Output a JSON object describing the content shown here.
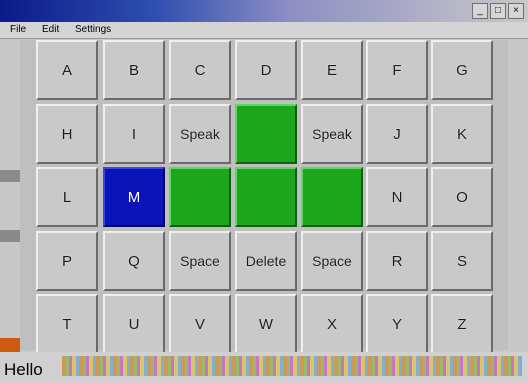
{
  "window": {
    "title": ""
  },
  "menu": [
    "File",
    "Edit",
    "Settings"
  ],
  "window_buttons": [
    "_",
    "□",
    "×"
  ],
  "grid": {
    "rows": [
      [
        {
          "label": "A"
        },
        {
          "label": "B"
        },
        {
          "label": "C"
        },
        {
          "label": "D"
        },
        {
          "label": "E"
        },
        {
          "label": "F"
        },
        {
          "label": "G"
        }
      ],
      [
        {
          "label": "H"
        },
        {
          "label": "I"
        },
        {
          "label": "Speak"
        },
        {
          "label": "",
          "color": "green"
        },
        {
          "label": "Speak"
        },
        {
          "label": "J"
        },
        {
          "label": "K"
        }
      ],
      [
        {
          "label": "L"
        },
        {
          "label": "M",
          "color": "blue"
        },
        {
          "label": "",
          "color": "green"
        },
        {
          "label": "",
          "color": "green"
        },
        {
          "label": "",
          "color": "green"
        },
        {
          "label": "N"
        },
        {
          "label": "O"
        }
      ],
      [
        {
          "label": "P"
        },
        {
          "label": "Q"
        },
        {
          "label": "Space"
        },
        {
          "label": "Delete"
        },
        {
          "label": "Space"
        },
        {
          "label": "R"
        },
        {
          "label": "S"
        }
      ],
      [
        {
          "label": "T"
        },
        {
          "label": "U"
        },
        {
          "label": "V"
        },
        {
          "label": "W"
        },
        {
          "label": "X"
        },
        {
          "label": "Y"
        },
        {
          "label": "Z"
        }
      ]
    ]
  },
  "output": {
    "text": "Hello"
  },
  "colors": {
    "green": "#1ea51e",
    "blue": "#0b14b8",
    "cell": "#c9c9c9"
  }
}
